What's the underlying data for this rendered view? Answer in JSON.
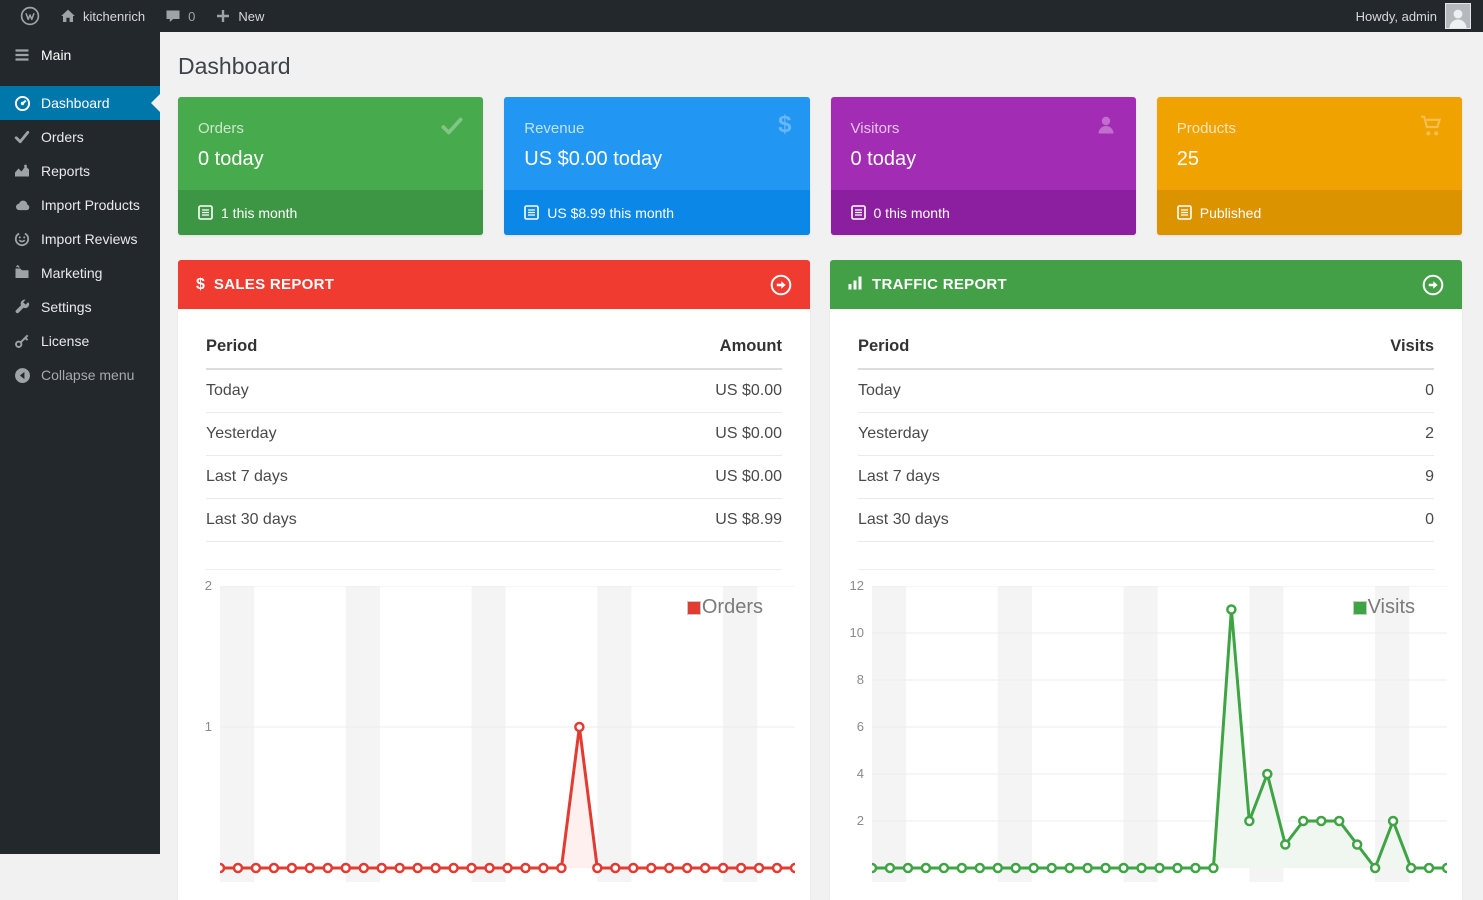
{
  "admin_bar": {
    "site_name": "kitchenrich",
    "comments_count": "0",
    "new_label": "New",
    "howdy": "Howdy, admin",
    "icons": [
      "wordpress-logo-icon",
      "home-icon",
      "comments-icon",
      "plus-icon",
      "avatar"
    ]
  },
  "sidebar": {
    "items": [
      {
        "label": "Main",
        "icon": "menu-icon",
        "active": false
      },
      {
        "label": "Dashboard",
        "icon": "dashboard-gauge-icon",
        "active": true
      },
      {
        "label": "Orders",
        "icon": "check-icon",
        "active": false
      },
      {
        "label": "Reports",
        "icon": "area-chart-icon",
        "active": false
      },
      {
        "label": "Import Products",
        "icon": "cloud-icon",
        "active": false
      },
      {
        "label": "Import Reviews",
        "icon": "smiley-icon",
        "active": false
      },
      {
        "label": "Marketing",
        "icon": "folder-icon",
        "active": false
      },
      {
        "label": "Settings",
        "icon": "wrench-icon",
        "active": false
      },
      {
        "label": "License",
        "icon": "key-icon",
        "active": false
      },
      {
        "label": "Collapse menu",
        "icon": "collapse-arrow-icon",
        "active": false
      }
    ],
    "active_color": "#0077ab",
    "bg_color": "#23282d"
  },
  "page": {
    "title": "Dashboard"
  },
  "cards": [
    {
      "title": "Orders",
      "value": "0 today",
      "footer": "1 this month",
      "color": "#47ab4d",
      "footer_color": "#3d9643",
      "icon": "check-icon",
      "icon_glyph": ""
    },
    {
      "title": "Revenue",
      "value": "US $0.00 today",
      "footer": "US $8.99 this month",
      "color": "#2196f3",
      "footer_color": "#0b87e7",
      "icon": "dollar-icon",
      "icon_glyph": "$"
    },
    {
      "title": "Visitors",
      "value": "0 today",
      "footer": "0 this month",
      "color": "#a32cb5",
      "footer_color": "#8c1f9f",
      "icon": "person-icon",
      "icon_glyph": ""
    },
    {
      "title": "Products",
      "value": "25",
      "footer": "Published",
      "color": "#f0a201",
      "footer_color": "#db9300",
      "icon": "cart-icon",
      "icon_glyph": ""
    }
  ],
  "sales_panel": {
    "title": "SALES REPORT",
    "icon": "dollar-icon",
    "icon_glyph": "$",
    "header_color": "#ef3b30",
    "columns": [
      "Period",
      "Amount"
    ],
    "rows": [
      [
        "Today",
        "US $0.00"
      ],
      [
        "Yesterday",
        "US $0.00"
      ],
      [
        "Last 7 days",
        "US $0.00"
      ],
      [
        "Last 30 days",
        "US $8.99"
      ]
    ]
  },
  "traffic_panel": {
    "title": "TRAFFIC REPORT",
    "icon": "bar-chart-icon",
    "header_color": "#43a047",
    "columns": [
      "Period",
      "Visits"
    ],
    "rows": [
      [
        "Today",
        "0"
      ],
      [
        "Yesterday",
        "2"
      ],
      [
        "Last 7 days",
        "9"
      ],
      [
        "Last 30 days",
        "0"
      ]
    ]
  },
  "chart_data": [
    {
      "type": "line",
      "name": "Orders",
      "x_unit": "day (last ~30 days, weekend bands shaded)",
      "values": [
        0,
        0,
        0,
        0,
        0,
        0,
        0,
        0,
        0,
        0,
        0,
        0,
        0,
        0,
        0,
        0,
        0,
        0,
        0,
        0,
        1,
        0,
        0,
        0,
        0,
        0,
        0,
        0,
        0,
        0,
        0,
        0,
        0
      ],
      "ylim": [
        0,
        2
      ],
      "yticks": [
        1,
        2
      ],
      "color": "#e23b32",
      "fill": "#fdf0ef",
      "marker": "open-circle",
      "legend_position": "top-right",
      "grid": "horizontal"
    },
    {
      "type": "line",
      "name": "Visits",
      "x_unit": "day (last ~30 days, weekend bands shaded)",
      "values": [
        0,
        0,
        0,
        0,
        0,
        0,
        0,
        0,
        0,
        0,
        0,
        0,
        0,
        0,
        0,
        0,
        0,
        0,
        0,
        0,
        11,
        2,
        4,
        1,
        2,
        2,
        2,
        1,
        0,
        2,
        0,
        0,
        0
      ],
      "ylim": [
        0,
        12
      ],
      "yticks": [
        2,
        4,
        6,
        8,
        10,
        12
      ],
      "color": "#3ea444",
      "fill": "#f0f7f0",
      "marker": "open-circle",
      "legend_position": "top-right",
      "grid": "horizontal"
    }
  ]
}
